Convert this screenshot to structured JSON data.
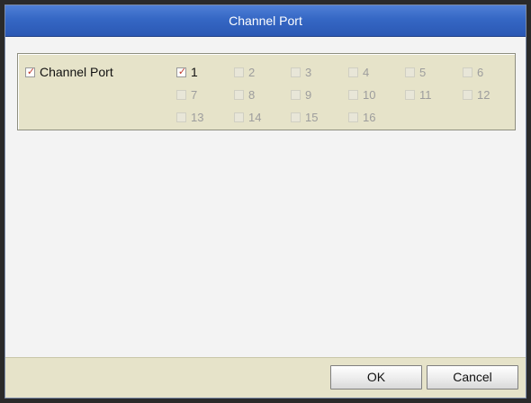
{
  "dialog": {
    "title": "Channel Port"
  },
  "channel_port": {
    "label": "Channel Port",
    "checked": true,
    "channels": [
      {
        "label": "1",
        "checked": true,
        "enabled": true
      },
      {
        "label": "2",
        "checked": false,
        "enabled": false
      },
      {
        "label": "3",
        "checked": false,
        "enabled": false
      },
      {
        "label": "4",
        "checked": false,
        "enabled": false
      },
      {
        "label": "5",
        "checked": false,
        "enabled": false
      },
      {
        "label": "6",
        "checked": false,
        "enabled": false
      },
      {
        "label": "7",
        "checked": false,
        "enabled": false
      },
      {
        "label": "8",
        "checked": false,
        "enabled": false
      },
      {
        "label": "9",
        "checked": false,
        "enabled": false
      },
      {
        "label": "10",
        "checked": false,
        "enabled": false
      },
      {
        "label": "11",
        "checked": false,
        "enabled": false
      },
      {
        "label": "12",
        "checked": false,
        "enabled": false
      },
      {
        "label": "13",
        "checked": false,
        "enabled": false
      },
      {
        "label": "14",
        "checked": false,
        "enabled": false
      },
      {
        "label": "15",
        "checked": false,
        "enabled": false
      },
      {
        "label": "16",
        "checked": false,
        "enabled": false
      }
    ]
  },
  "footer": {
    "ok_label": "OK",
    "cancel_label": "Cancel"
  },
  "icons": {
    "checkmark": "checkmark-icon"
  },
  "colors": {
    "title_bar": "#3567c4",
    "panel": "#e6e3c9",
    "check": "#c0392b"
  }
}
